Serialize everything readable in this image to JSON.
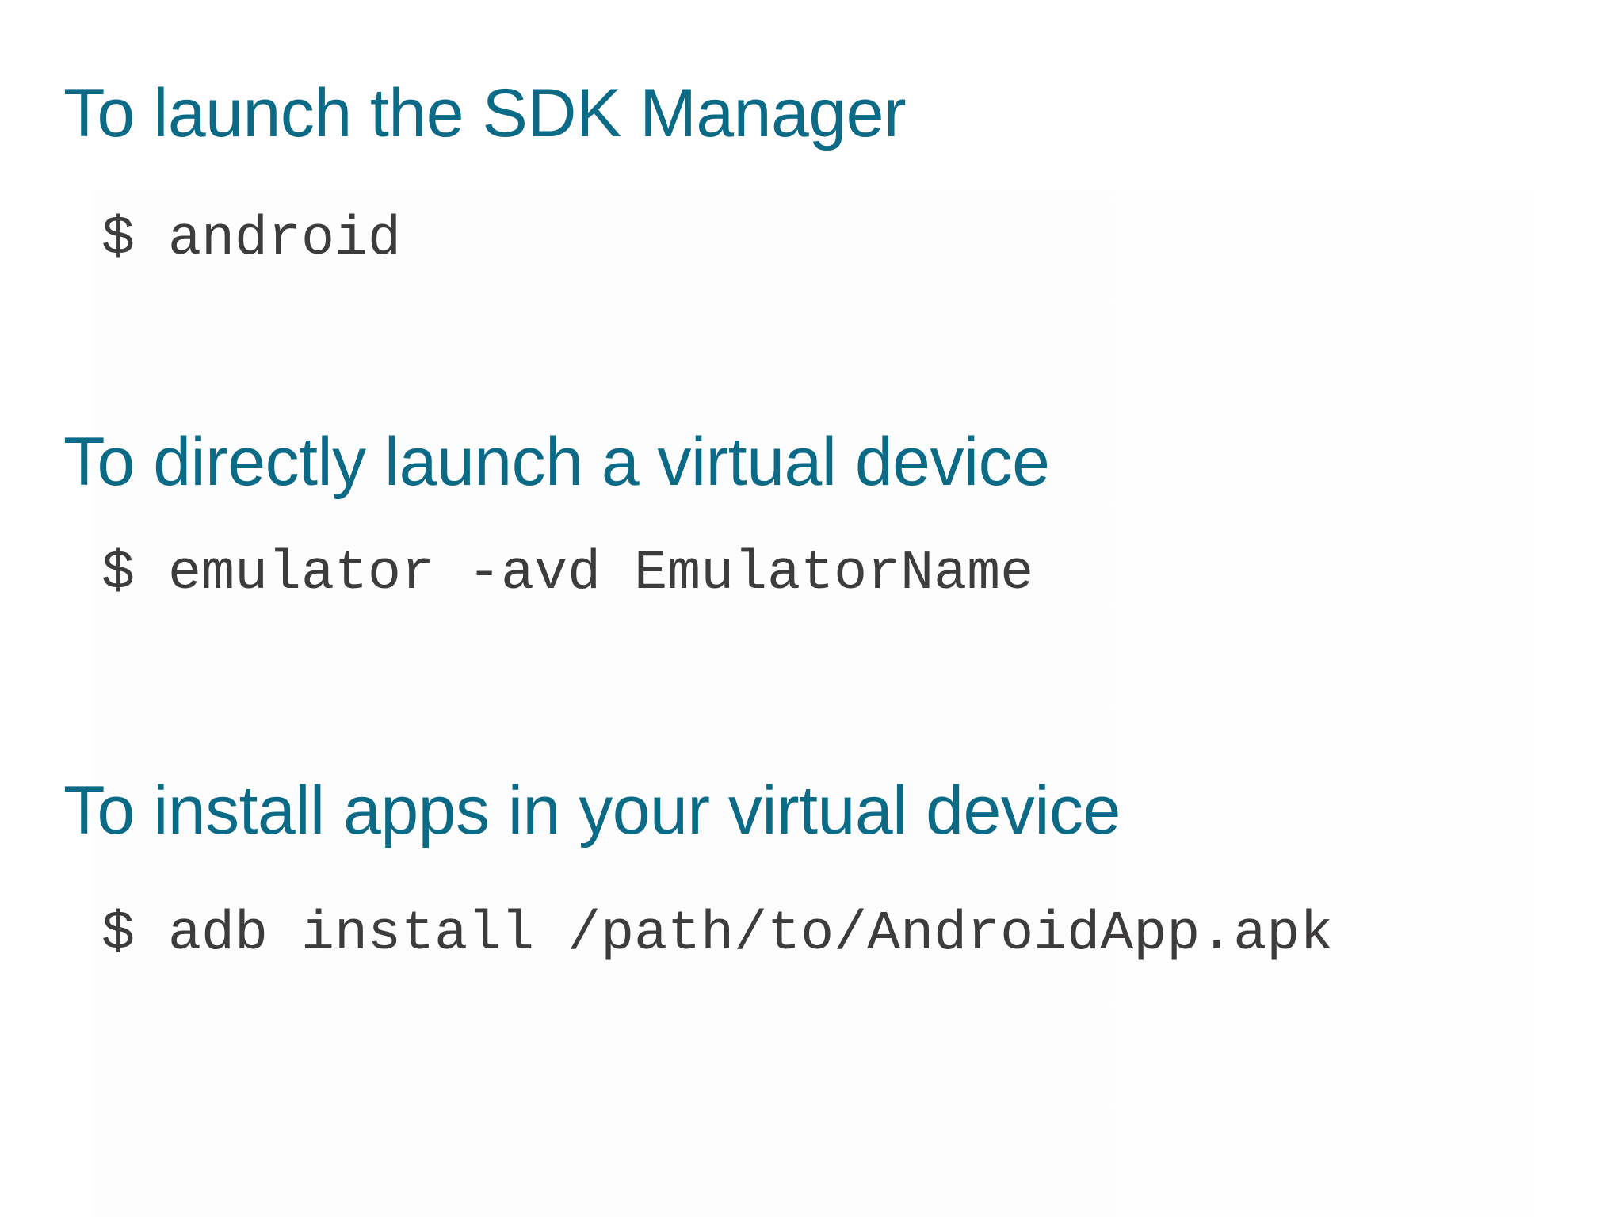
{
  "colors": {
    "heading": "#0b6a86",
    "command": "#3d3b3c",
    "background": "#ffffff"
  },
  "sections": [
    {
      "heading": "To launch the SDK Manager",
      "prompt": "$",
      "command": "android"
    },
    {
      "heading": "To directly launch a virtual device",
      "prompt": "$",
      "command": "emulator -avd EmulatorName"
    },
    {
      "heading": "To install apps in your virtual device",
      "prompt": "$",
      "command": "adb install /path/to/AndroidApp.apk"
    }
  ]
}
